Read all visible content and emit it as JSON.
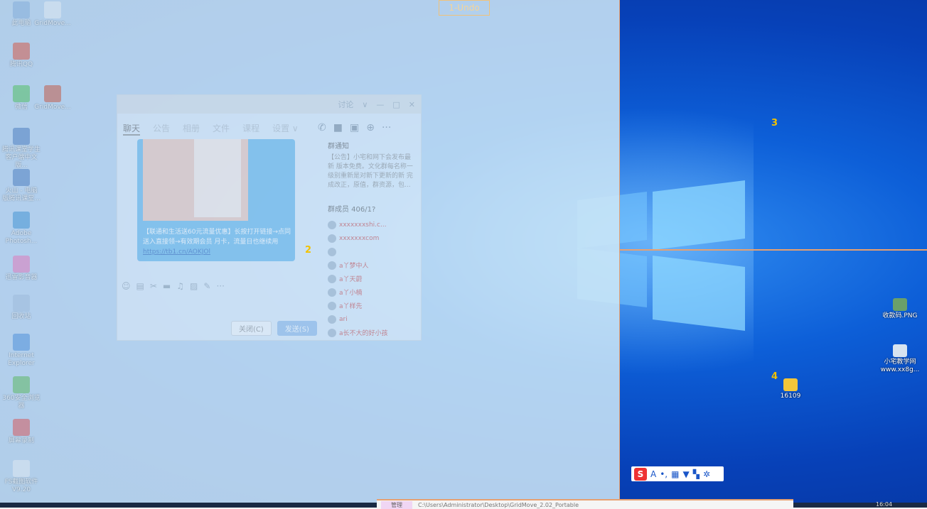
{
  "overlay": {
    "undo_label": "1-Undo",
    "zone_numbers": [
      "2",
      "3",
      "4"
    ]
  },
  "desktop_icons_left": [
    {
      "label": "此电脑",
      "icon": "computer-icon",
      "color": "#7aa7d8"
    },
    {
      "label": "GridMove...",
      "icon": "file-icon",
      "color": "#e8eef4"
    },
    {
      "label": "腾讯QQ",
      "icon": "qq-icon",
      "color": "#d9442b"
    },
    {
      "label": "微信",
      "icon": "wechat-icon",
      "color": "#3fba4a"
    },
    {
      "label": "GridMove...",
      "icon": "archive-icon",
      "color": "#c4452a"
    },
    {
      "label": "腾讯课堂学生\n客户端中文版...",
      "icon": "app-icon",
      "color": "#3a6fb8"
    },
    {
      "label": "火山 - 电脑\n版腾讯课堂...",
      "icon": "app-icon",
      "color": "#3a6fb8"
    },
    {
      "label": "Adobe\nPhotosh...",
      "icon": "photoshop-icon",
      "color": "#2f8ad0"
    },
    {
      "label": "迅雷影音器",
      "icon": "player-icon",
      "color": "#e86ab2"
    },
    {
      "label": "回收站",
      "icon": "recycle-bin-icon",
      "color": "#9bb8d8"
    },
    {
      "label": "Internet\nExplorer",
      "icon": "ie-icon",
      "color": "#3b86d8"
    },
    {
      "label": "360安全浏览\n器",
      "icon": "browser-icon",
      "color": "#4db44a"
    },
    {
      "label": "屏幕录制",
      "icon": "recorder-icon",
      "color": "#d44"
    },
    {
      "label": "FS截图软件\nV9.20",
      "icon": "tool-icon",
      "color": "#e8eef4"
    }
  ],
  "desktop_icons_right": [
    {
      "label": "收款码.PNG",
      "icon": "image-file-icon",
      "color": "#6aa06a"
    },
    {
      "label": "小宅教学网\nwww.xx8g...",
      "icon": "shortcut-icon",
      "color": "#d8e4f0"
    },
    {
      "label": "16109",
      "icon": "folder-zip-icon",
      "color": "#f3c63a"
    }
  ],
  "chat_window": {
    "title_controls": [
      "讨论",
      "∨",
      "—",
      "□",
      "✕"
    ],
    "tabs": [
      "聊天",
      "公告",
      "相册",
      "文件",
      "课程",
      "设置 ∨"
    ],
    "message": "【联通和生活送60元流量优惠】长按打开链接→点同 送入直接领→有效期会员 月卡，流量日也继续用",
    "message_link": "https://tb1.cn/AOKJOl",
    "notice_header": "群通知",
    "notice_text": "【公告】小宅和网下会发布最新 版本免费。文化群每名称一 级别重新是对新下更新的新 完成改正，原值，群资源，包...",
    "members_header": "群成员 406/1?",
    "members": [
      "xxxxxxxshi.c...",
      "xxxxxxxcom",
      "",
      "a丫梦中人",
      "a丫天蔚",
      "a丫小楠",
      "a丫样先",
      "ari",
      "a长不大的好小孩"
    ],
    "buttons": {
      "close": "关闭(C)",
      "send": "发送(S)"
    }
  },
  "ime_bar": {
    "logo": "S",
    "items": [
      "A",
      "•,",
      "▦",
      "▼",
      "▚",
      "✲"
    ]
  },
  "taskbar": {
    "explorer_tab": "管理",
    "explorer_path": "C:\\Users\\Administrator\\Desktop\\GridMove_2.02_Portable",
    "clock": "16:04"
  }
}
